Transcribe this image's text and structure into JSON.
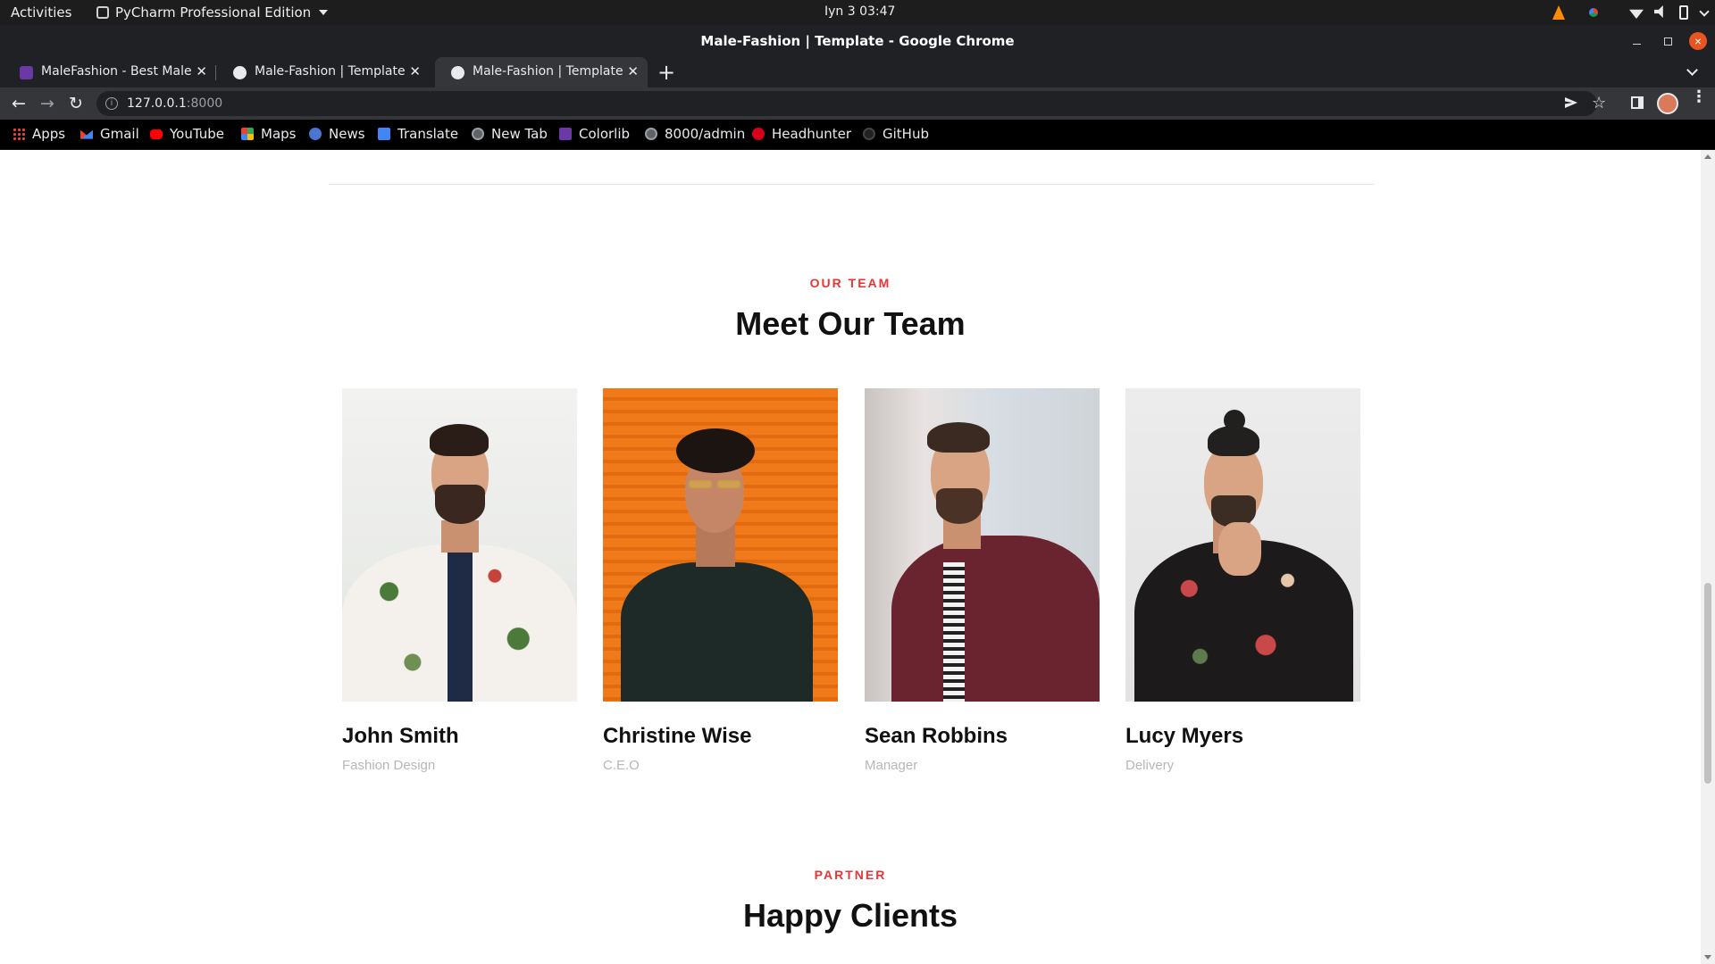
{
  "os_bar": {
    "activities": "Activities",
    "app_name": "PyCharm Professional Edition",
    "clock": "Iyn 3  03:47"
  },
  "window": {
    "title": "Male-Fashion | Template - Google Chrome"
  },
  "tabs": [
    {
      "label": "MaleFashion - Best Male F",
      "icon": "colorlib-favicon",
      "active": false
    },
    {
      "label": "Male-Fashion | Template",
      "icon": "globe-favicon",
      "active": false
    },
    {
      "label": "Male-Fashion | Template",
      "icon": "globe-favicon",
      "active": true
    }
  ],
  "toolbar": {
    "url_host": "127.0.0.1",
    "url_port": ":8000"
  },
  "bookmarks": [
    {
      "label": "Apps",
      "icon": "apps-grid-icon"
    },
    {
      "label": "Gmail",
      "icon": "gmail-icon"
    },
    {
      "label": "YouTube",
      "icon": "youtube-icon"
    },
    {
      "label": "Maps",
      "icon": "maps-icon"
    },
    {
      "label": "News",
      "icon": "news-icon"
    },
    {
      "label": "Translate",
      "icon": "translate-icon"
    },
    {
      "label": "New Tab",
      "icon": "globe-icon"
    },
    {
      "label": "Colorlib",
      "icon": "colorlib-icon"
    },
    {
      "label": "8000/admin",
      "icon": "globe-icon"
    },
    {
      "label": "Headhunter",
      "icon": "headhunter-icon"
    },
    {
      "label": "GitHub",
      "icon": "github-icon"
    }
  ],
  "team_section": {
    "label": "OUR TEAM",
    "title": "Meet Our Team",
    "members": [
      {
        "name": "John Smith",
        "role": "Fashion Design"
      },
      {
        "name": "Christine Wise",
        "role": "C.E.O"
      },
      {
        "name": "Sean Robbins",
        "role": "Manager"
      },
      {
        "name": "Lucy Myers",
        "role": "Delivery"
      }
    ]
  },
  "partner_section": {
    "label": "PARTNER",
    "title": "Happy Clients"
  },
  "colors": {
    "accent_red": "#e53637",
    "heading": "#111111",
    "muted_text": "#b7b7b7"
  }
}
